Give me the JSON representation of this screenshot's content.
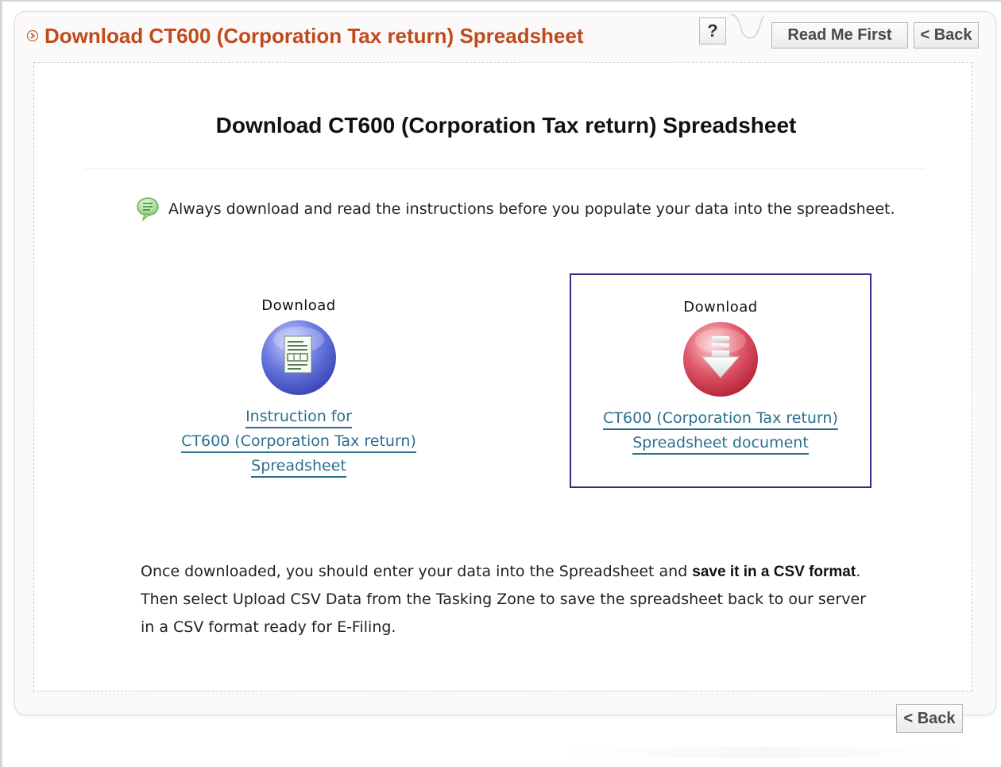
{
  "header": {
    "title": "Download CT600 (Corporation Tax return) Spreadsheet",
    "help_label": "?",
    "readme_label": "Read Me First",
    "back_label": "< Back"
  },
  "main": {
    "title": "Download CT600 (Corporation Tax return) Spreadsheet",
    "notice": "Always download and read the instructions before you populate your data into the spreadsheet."
  },
  "downloads": [
    {
      "heading": "Download",
      "icon": "document-icon",
      "color": "#5b6bd8",
      "lines": [
        "Instruction for",
        "CT600 (Corporation Tax return)",
        "Spreadsheet"
      ]
    },
    {
      "heading": "Download",
      "icon": "download-arrow-icon",
      "color": "#d9404f",
      "lines": [
        "CT600 (Corporation Tax return)",
        "Spreadsheet document"
      ]
    }
  ],
  "footer": {
    "part1": "Once downloaded, you should enter your data into the Spreadsheet and ",
    "bold": "save it in a CSV format",
    "part2": ".",
    "line2": "Then select Upload CSV Data from the Tasking Zone to save the spreadsheet back to our server",
    "line3": "in a CSV format ready for E-Filing.",
    "back_label": "< Back"
  },
  "colors": {
    "title_accent": "#c04a1b",
    "link": "#2a6f8e",
    "selected_border": "#2f2f8a"
  }
}
